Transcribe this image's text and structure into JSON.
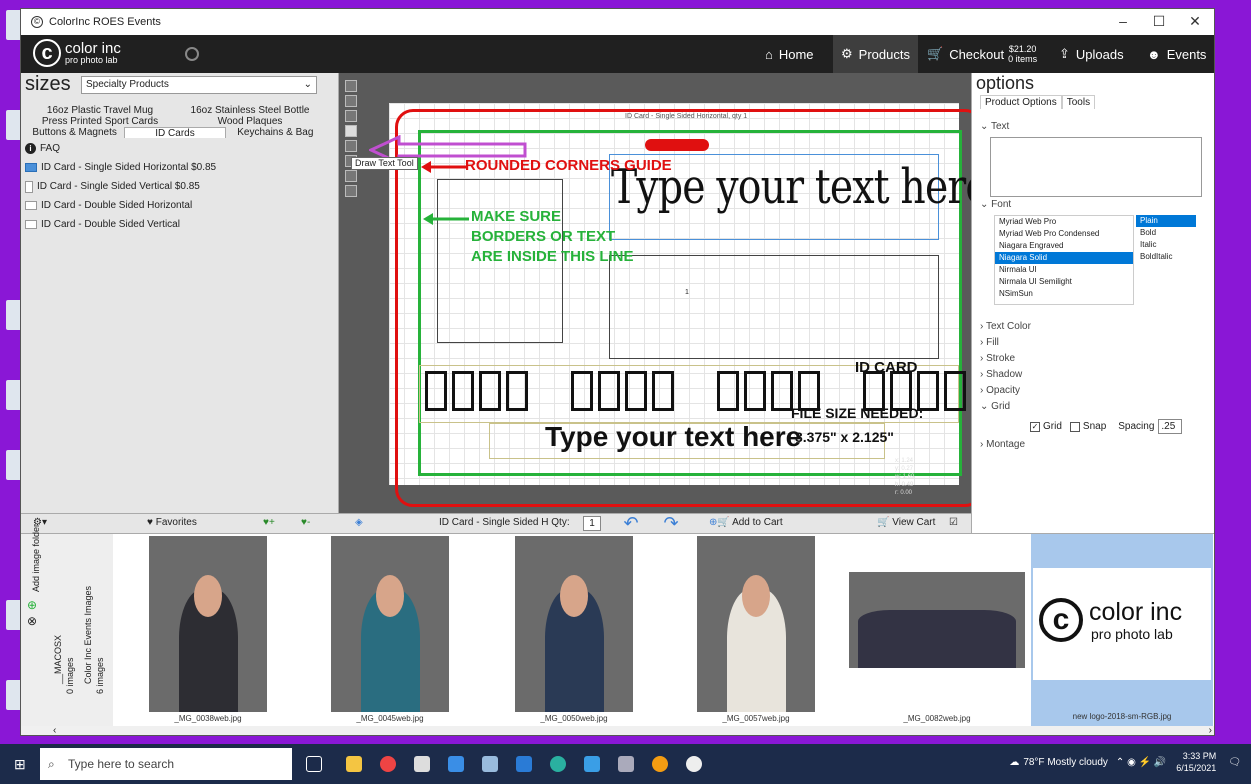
{
  "window": {
    "title": "ColorInc ROES Events"
  },
  "appbar": {
    "logo_main": "color inc",
    "logo_sub": "pro photo lab",
    "home": "Home",
    "products": "Products",
    "checkout": "Checkout",
    "checkout_amount": "$21.20",
    "checkout_items": "0 items",
    "uploads": "Uploads",
    "events": "Events"
  },
  "sizes": {
    "title": "sizes",
    "category": "Specialty Products",
    "tabs_row1": [
      "16oz Plastic Travel Mug",
      "16oz Stainless Steel Bottle"
    ],
    "tabs_row2": [
      "Press Printed Sport Cards",
      "Wood Plaques"
    ],
    "tabs_row3": [
      "Buttons & Magnets",
      "ID Cards",
      "Keychains & Bag Tags"
    ],
    "faq": "FAQ",
    "items": [
      "ID Card - Single Sided Horizontal $0.85",
      "ID Card - Single Sided Vertical $0.85",
      "ID Card - Double Sided Horizontal",
      "ID Card - Double Sided Vertical"
    ]
  },
  "canvas": {
    "tooltip": "Draw Text Tool",
    "card_caption": "ID Card - Single Sided Horizontal, qty 1",
    "guide_red": "ROUNDED CORNERS GUIDE",
    "guide_green_1": "MAKE SURE",
    "guide_green_2": "BORDERS OR TEXT",
    "guide_green_3": "ARE INSIDE THIS LINE",
    "big_text": "Type your text here",
    "box2_number": "1",
    "id_card_label": "ID CARD",
    "file_size_1": "FILE SIZE NEEDED:",
    "small_text": "Type your text here",
    "file_size_2": "3.375\" x 2.125\"",
    "coords": [
      "x: 1.24",
      "y: 0.27",
      "w: 1.69",
      "h: 0.49",
      "r: 0.00"
    ]
  },
  "bottombar": {
    "favorites": "Favorites",
    "product_label": "ID Card - Single Sided H Qty:",
    "qty": "1",
    "add_to_cart": "Add to Cart",
    "view_cart": "View Cart"
  },
  "options": {
    "title": "options",
    "tab1": "Product Options",
    "tab2": "Tools",
    "text_section": "Text",
    "font_section": "Font",
    "fonts": [
      "Myriad Web Pro",
      "Myriad Web Pro Condensed",
      "Niagara Engraved",
      "Niagara Solid",
      "Nirmala UI",
      "Nirmala UI Semilight",
      "NSimSun"
    ],
    "selected_font": "Niagara Solid",
    "styles": [
      "Plain",
      "Bold",
      "Italic",
      "BoldItalic"
    ],
    "selected_style": "Plain",
    "sections": [
      "Text Color",
      "Fill",
      "Stroke",
      "Shadow",
      "Opacity"
    ],
    "grid_section": "Grid",
    "grid_label": "Grid",
    "grid_checked": true,
    "snap_label": "Snap",
    "snap_checked": false,
    "spacing_label": "Spacing",
    "spacing_value": ".25",
    "montage": "Montage"
  },
  "strip": {
    "add_folder": "Add image folder",
    "folder1": "__MACOSX",
    "folder1_count": "0 images",
    "folder2": "Color Inc Events Images",
    "folder2_count": "6 images",
    "images": [
      "_MG_0038web.jpg",
      "_MG_0045web.jpg",
      "_MG_0050web.jpg",
      "_MG_0057web.jpg",
      "_MG_0082web.jpg",
      "new logo-2018-sm-RGB.jpg"
    ],
    "logo_main": "color inc",
    "logo_sub": "pro photo lab"
  },
  "taskbar": {
    "search_placeholder": "Type here to search",
    "weather": "78°F  Mostly cloudy",
    "time": "3:33 PM",
    "date": "6/15/2021"
  },
  "colors": {
    "accent_purple": "#8a17d6",
    "guide_red": "#e01010",
    "guide_green": "#26b23a",
    "select_blue": "#0078d7"
  }
}
